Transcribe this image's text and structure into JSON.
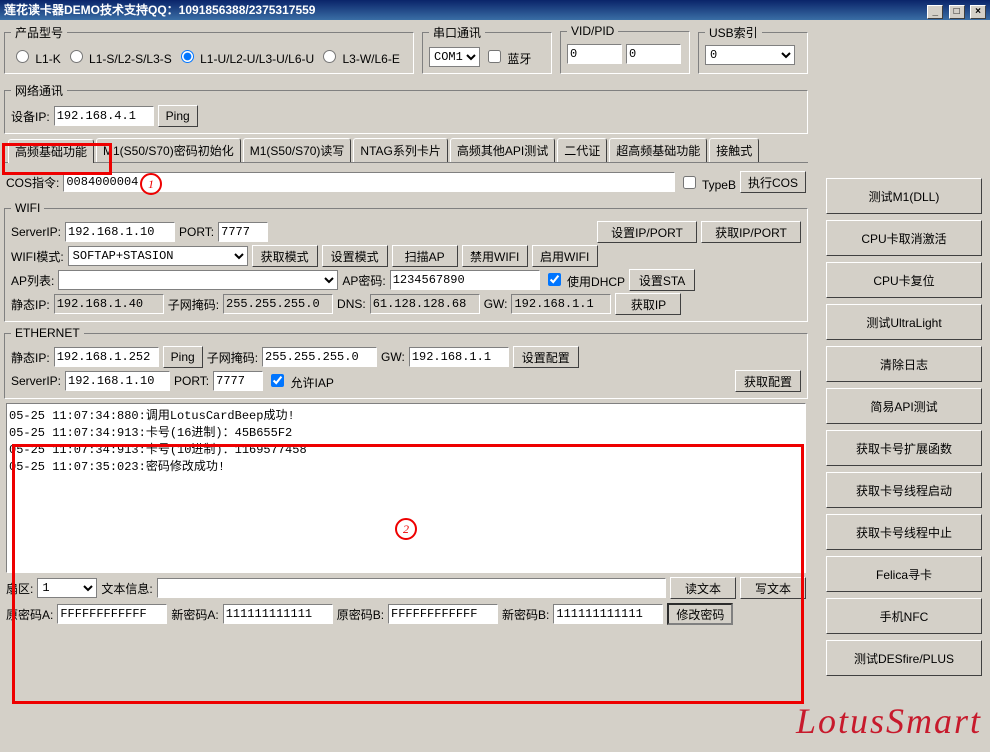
{
  "titlebar": "莲花读卡器DEMO技术支持QQ：1091856388/2375317559",
  "groups": {
    "product": {
      "legend": "产品型号",
      "opts": [
        "L1-K",
        "L1-S/L2-S/L3-S",
        "L1-U/L2-U/L3-U/L6-U",
        "L3-W/L6-E"
      ],
      "selected": 2
    },
    "serial": {
      "legend": "串口通讯",
      "port": "COM1",
      "bt": "蓝牙"
    },
    "vidpid": {
      "legend": "VID/PID",
      "vid": "0",
      "pid": "0"
    },
    "usb": {
      "legend": "USB索引",
      "val": "0"
    },
    "net": {
      "legend": "网络通讯",
      "ip_lbl": "设备IP:",
      "ip": "192.168.4.1",
      "ping": "Ping"
    }
  },
  "tabs": [
    "高频基础功能",
    "M1(S50/S70)密码初始化",
    "M1(S50/S70)读写",
    "NTAG系列卡片",
    "高频其他API测试",
    "二代证",
    "超高频基础功能",
    "接触式"
  ],
  "tab_active": 0,
  "cos": {
    "lbl": "COS指令:",
    "val": "0084000004",
    "typeb": "TypeB",
    "exec": "执行COS"
  },
  "wifi": {
    "legend": "WIFI",
    "srvip_lbl": "ServerIP:",
    "srvip": "192.168.1.10",
    "port_lbl": "PORT:",
    "port": "7777",
    "setip": "设置IP/PORT",
    "getip": "获取IP/PORT",
    "mode_lbl": "WIFI模式:",
    "mode": "SOFTAP+STASION",
    "getmode": "获取模式",
    "setmode": "设置模式",
    "scanap": "扫描AP",
    "disable": "禁用WIFI",
    "enable": "启用WIFI",
    "aplist_lbl": "AP列表:",
    "appwd_lbl": "AP密码:",
    "appwd": "1234567890",
    "dhcp": "使用DHCP",
    "setsta": "设置STA",
    "sip_lbl": "静态IP:",
    "sip": "192.168.1.40",
    "mask_lbl": "子网掩码:",
    "mask": "255.255.255.0",
    "dns_lbl": "DNS:",
    "dns": "61.128.128.68",
    "gw_lbl": "GW:",
    "gw": "192.168.1.1",
    "getip2": "获取IP"
  },
  "eth": {
    "legend": "ETHERNET",
    "sip_lbl": "静态IP:",
    "sip": "192.168.1.252",
    "ping": "Ping",
    "mask_lbl": "子网掩码:",
    "mask": "255.255.255.0",
    "gw_lbl": "GW:",
    "gw": "192.168.1.1",
    "setcfg": "设置配置",
    "srvip_lbl": "ServerIP:",
    "srvip": "192.168.1.10",
    "port_lbl": "PORT:",
    "port": "7777",
    "iap": "允许IAP",
    "getcfg": "获取配置"
  },
  "log": "05-25 11:07:34:880:调用LotusCardBeep成功!\n05-25 11:07:34:913:卡号(16进制)：45B655F2\n05-25 11:07:34:913:卡号(10进制)：1169577458\n05-25 11:07:35:023:密码修改成功!",
  "sector": {
    "lbl": "扇区:",
    "val": "1",
    "text_lbl": "文本信息:",
    "text": "",
    "read": "读文本",
    "write": "写文本"
  },
  "pwd": {
    "oa_lbl": "原密码A:",
    "oa": "FFFFFFFFFFFF",
    "na_lbl": "新密码A:",
    "na": "111111111111",
    "ob_lbl": "原密码B:",
    "ob": "FFFFFFFFFFFF",
    "nb_lbl": "新密码B:",
    "nb": "111111111111",
    "btn": "修改密码"
  },
  "side": [
    "测试M1(DLL)",
    "CPU卡取消激活",
    "CPU卡复位",
    "测试UltraLight",
    "清除日志",
    "简易API测试",
    "获取卡号扩展函数",
    "获取卡号线程启动",
    "获取卡号线程中止",
    "Felica寻卡",
    "手机NFC",
    "测试DESfire/PLUS"
  ],
  "annot": {
    "c1": "1",
    "c2": "2"
  },
  "watermark": "LotusSmart"
}
